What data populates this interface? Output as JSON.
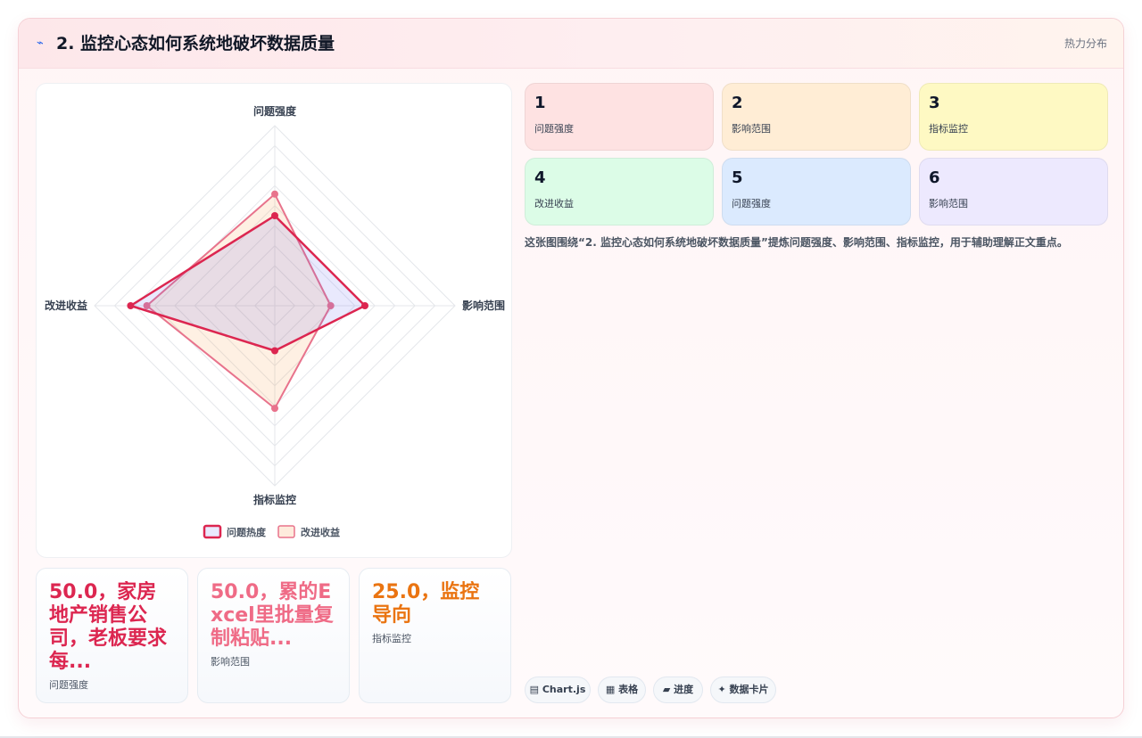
{
  "header": {
    "icon": "chart-line-icon",
    "title": "2. 监控心态如何系统地破坏数据质量",
    "tag": "热力分布"
  },
  "chart_data": {
    "type": "radar",
    "axes": [
      "问题强度",
      "影响范围",
      "指标监控",
      "改进收益"
    ],
    "series": [
      {
        "name": "问题热度",
        "values": [
          50,
          50,
          25,
          80
        ],
        "color": "#dc2650"
      },
      {
        "name": "改进收益",
        "values": [
          62,
          31,
          57,
          71
        ],
        "color": "#e8738c"
      }
    ],
    "rmax": 100,
    "ring_count": 9,
    "grid": true,
    "legend_position": "bottom"
  },
  "stats": [
    {
      "value": "50.0，家房地产销售公司，老板要求每...",
      "label": "问题强度",
      "color": "#dc2650"
    },
    {
      "value": "50.0，累的Excel里批量复制粘贴...",
      "label": "影响范围",
      "color": "#ef6b86"
    },
    {
      "value": "25.0，监控导向",
      "label": "指标监控",
      "color": "#ea7411"
    }
  ],
  "tiles": [
    {
      "num": "1",
      "label": "问题强度",
      "bg": "#fee2e2"
    },
    {
      "num": "2",
      "label": "影响范围",
      "bg": "#ffedd5"
    },
    {
      "num": "3",
      "label": "指标监控",
      "bg": "#fef9c3"
    },
    {
      "num": "4",
      "label": "改进收益",
      "bg": "#dcfce7"
    },
    {
      "num": "5",
      "label": "问题强度",
      "bg": "#dbeafe"
    },
    {
      "num": "6",
      "label": "影响范围",
      "bg": "#ede9fe"
    }
  ],
  "description": "这张图围绕“2. 监控心态如何系统地破坏数据质量”提炼问题强度、影响范围、指标监控，用于辅助理解正文重点。",
  "chips": [
    {
      "icon": "chart-icon",
      "glyph": "▤",
      "label": "Chart.js"
    },
    {
      "icon": "table-icon",
      "glyph": "▦",
      "label": "表格"
    },
    {
      "icon": "progress-icon",
      "glyph": "▰",
      "label": "进度"
    },
    {
      "icon": "sparkle-icon",
      "glyph": "✦",
      "label": "数据卡片"
    }
  ]
}
